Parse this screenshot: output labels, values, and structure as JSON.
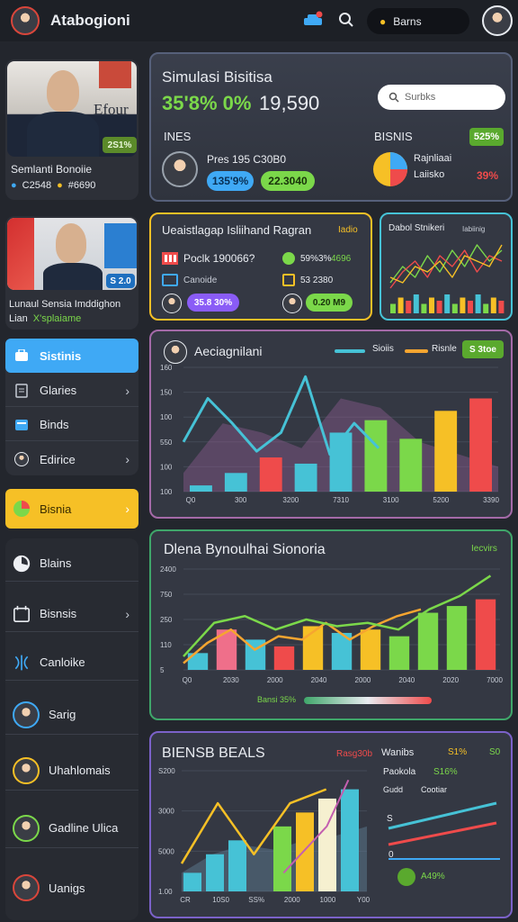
{
  "app": {
    "title": "Atabogioni",
    "search_pill": "Barns"
  },
  "profile_card_1": {
    "name": "Semlanti Bonoiie",
    "stat_a": "C2548",
    "stat_b": "#6690",
    "badge": "2S1%",
    "sign": "Efour"
  },
  "profile_card_2": {
    "line1": "Lunaul Sensia Imddighon",
    "line2_a": "Lian",
    "line2_b": "X'splaiame",
    "badge": "S 2.0"
  },
  "sidebar_top": [
    {
      "label": "Sistinis",
      "active": true,
      "icon": "briefcase-icon"
    },
    {
      "label": "Glaries",
      "active": false,
      "icon": "document-icon",
      "chevron": true
    },
    {
      "label": "Binds",
      "active": false,
      "icon": "window-icon"
    },
    {
      "label": "Edirice",
      "active": false,
      "icon": "person-icon",
      "chevron": true
    }
  ],
  "sidebar_yellow": {
    "label": "Bisnia"
  },
  "sidebar_bottom": [
    {
      "label": "Blains",
      "icon": "pie-icon"
    },
    {
      "label": "Bisnsis",
      "icon": "calendar-icon",
      "chevron": true
    },
    {
      "label": "Canloike",
      "icon": "network-icon"
    },
    {
      "label": "Sarig",
      "icon": "person-avatar"
    },
    {
      "label": "Uhahlomais",
      "icon": "person-avatar"
    },
    {
      "label": "Gadline Ulica",
      "icon": "person-avatar"
    },
    {
      "label": "Uanigs",
      "icon": "person-avatar"
    }
  ],
  "summary": {
    "title": "Simulasi Bisitisa",
    "big_green": "35'8% 0%",
    "big_white": "19,590",
    "search_placeholder": "Surbks",
    "left_label": "INES",
    "right_label": "BISNIS",
    "right_badge": "525%",
    "person_text": "Pres  195 C30B0",
    "pill_blue": "135'9%",
    "pill_green": "22.3040",
    "pie_label_1": "Rajnliaai",
    "pie_label_2": "Laiisko",
    "pie_value": "39%"
  },
  "mini_card": {
    "title": "Ueaistlagap Isliihand Ragran",
    "tag": "Iadio",
    "row1_left": "Poclk 190066?",
    "row1_right_a": "59%3%",
    "row1_right_b": "4696",
    "row2_left": "Canoide",
    "row2_right": "53 2380",
    "pill_purple": "35.8 30%",
    "pill_green": "0.20 M9"
  },
  "mini_chart_card": {
    "title": "Dabol Stnikeri",
    "legend": "Iabiinig"
  },
  "chart1": {
    "title": "Aeciagnilani",
    "legend_a": "Sioiis",
    "legend_b": "Risnle",
    "badge": "S 3toe",
    "y_ticks": [
      "160",
      "150",
      "100",
      "550",
      "100",
      "100"
    ],
    "x_ticks": [
      "Q0",
      "300",
      "3200",
      "7310",
      "3100",
      "5200",
      "3390"
    ]
  },
  "chart2": {
    "title": "Dlena Bynoulhai Sionoria",
    "tag": "Iecvirs",
    "y_ticks": [
      "2400",
      "750",
      "250",
      "110",
      "5"
    ],
    "x_ticks": [
      "Q0",
      "2030",
      "2000",
      "2040",
      "2000",
      "2040",
      "2020",
      "7000"
    ],
    "footer": "Bansi 35%"
  },
  "chart3": {
    "title": "BIENSB BEALS",
    "tag": "Rasg30b",
    "y_ticks": [
      "S200",
      "3000",
      "5000",
      "1.00"
    ],
    "x_ticks": [
      "CR",
      "10S0",
      "SS%",
      "2000",
      "1000",
      "Y00"
    ],
    "side_title": "Wanibs",
    "side_a": "S1%",
    "side_b": "S0",
    "row1_label": "Paokola",
    "row1_value": "S16%",
    "row2_label": "Gudd",
    "row2_value": "Cootiar",
    "axis_s": "S",
    "axis_0": "0",
    "pill": "A49%"
  },
  "chart_data": [
    {
      "type": "line",
      "title": "Dabol Stnikeri",
      "series": [
        {
          "values": [
            2,
            5,
            3,
            7,
            4,
            8,
            5,
            9,
            6,
            8
          ]
        },
        {
          "values": [
            1,
            4,
            6,
            3,
            7,
            5,
            8,
            4,
            7,
            6
          ]
        },
        {
          "values": [
            3,
            2,
            5,
            4,
            6,
            3,
            7,
            6,
            5,
            9
          ]
        }
      ],
      "bars": [
        3,
        5,
        4,
        6,
        3,
        5,
        4,
        6,
        3,
        5,
        4,
        6,
        3,
        5,
        4
      ]
    },
    {
      "type": "bar",
      "title": "Aeciagnilani",
      "categories": [
        "Q0",
        "300",
        "3200",
        "7310",
        "3100",
        "5200",
        "3390"
      ],
      "bars": [
        10,
        30,
        55,
        45,
        95,
        115,
        85,
        130,
        150
      ],
      "line": [
        80,
        150,
        110,
        65,
        95,
        185,
        60,
        110,
        70
      ],
      "area": [
        30,
        110,
        95,
        70,
        150,
        135,
        80,
        60,
        40
      ],
      "ylim": [
        0,
        200
      ]
    },
    {
      "type": "bar",
      "title": "Dlena Bynoulhai Sionoria",
      "categories": [
        "Q0",
        "2030",
        "2000",
        "2040",
        "2000",
        "2040",
        "2020",
        "7000"
      ],
      "bars": [
        25,
        60,
        45,
        35,
        65,
        55,
        60,
        50,
        85,
        95,
        105
      ],
      "line_green": [
        20,
        70,
        80,
        60,
        75,
        65,
        70,
        60,
        90,
        110,
        140
      ],
      "line_orange": [
        10,
        40,
        60,
        30,
        50,
        45,
        70,
        45,
        65,
        80,
        90
      ],
      "ylim": [
        0,
        150
      ]
    },
    {
      "type": "bar",
      "title": "BIENSB BEALS",
      "categories": [
        "CR",
        "10S0",
        "SS%",
        "2000",
        "1000",
        "Y00"
      ],
      "bars": [
        20,
        40,
        55,
        70,
        85,
        100,
        110
      ],
      "line_yellow": [
        30,
        95,
        40,
        95,
        110
      ],
      "line_pink": [
        20,
        45,
        70,
        120
      ],
      "ylim": [
        0,
        130
      ]
    }
  ],
  "colors": {
    "green": "#7bd84a",
    "blue": "#3fa9f5",
    "yellow": "#f6c026",
    "red": "#ef4b4b",
    "teal": "#46c2d6",
    "purple": "#8a5cf6"
  }
}
